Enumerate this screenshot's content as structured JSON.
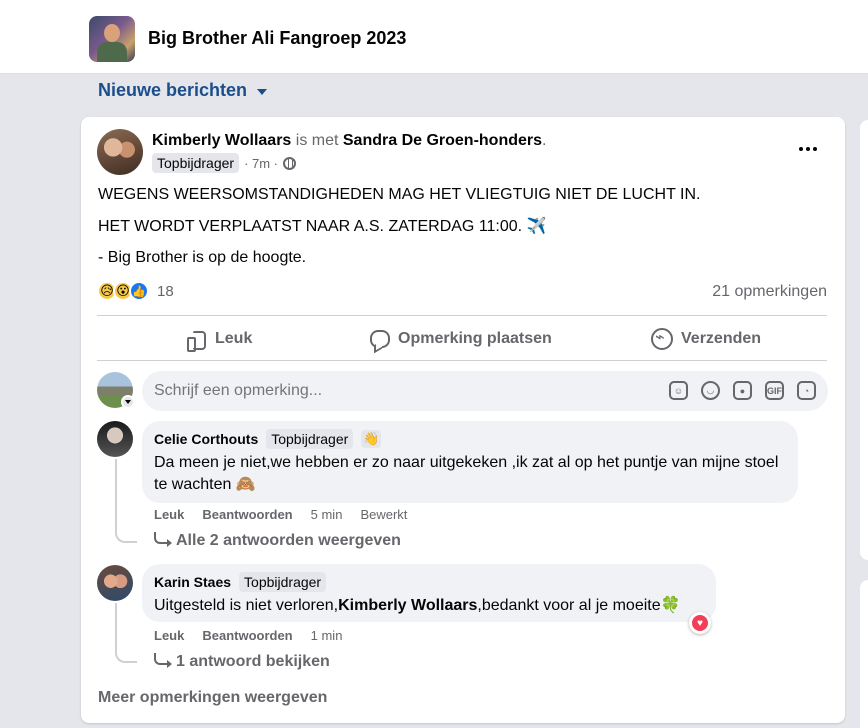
{
  "group": {
    "name": "Big Brother Ali Fangroep 2023"
  },
  "sort": {
    "label": "Nieuwe berichten"
  },
  "post": {
    "author": "Kimberly Wollaars",
    "with_text": " is met ",
    "tagged": "Sandra De Groen-honders",
    "tag_suffix": ".",
    "badge": "Topbijdrager",
    "time": "· 7m ·",
    "lines": [
      "WEGENS WEERSOMSTANDIGHEDEN MAG HET VLIEGTUIG NIET DE LUCHT IN.",
      "HET WORDT VERPLAATST NAAR A.S. ZATERDAG 11:00. ✈️",
      "- Big Brother is op de hoogte."
    ],
    "reaction_count": "18",
    "comment_count": "21 opmerkingen",
    "actions": {
      "like": "Leuk",
      "comment": "Opmerking plaatsen",
      "send": "Verzenden"
    }
  },
  "composer": {
    "placeholder": "Schrijf een opmerking..."
  },
  "comments": [
    {
      "author": "Celie Corthouts",
      "badge": "Topbijdrager",
      "text": "Da meen je niet,we hebben er zo naar uitgekeken ,ik zat al op het puntje van mijne stoel te wachten 🙈",
      "like": "Leuk",
      "reply": "Beantwoorden",
      "time": "5 min",
      "edited": "Bewerkt",
      "replies_link": "Alle 2 antwoorden weergeven"
    },
    {
      "author": "Karin Staes",
      "badge": "Topbijdrager",
      "text_before": "Uitgesteld is niet verloren,",
      "mention": "Kimberly Wollaars",
      "text_after": ",bedankt voor al je moeite🍀",
      "like": "Leuk",
      "reply": "Beantwoorden",
      "time": "1 min",
      "replies_link": "1 antwoord bekijken"
    }
  ],
  "more_comments": "Meer opmerkingen weergeven",
  "colors": {
    "link_blue": "#1b4e8a",
    "secondary_text": "#65676b",
    "bubble_bg": "#f0f2f5",
    "heart": "#f33e58"
  }
}
